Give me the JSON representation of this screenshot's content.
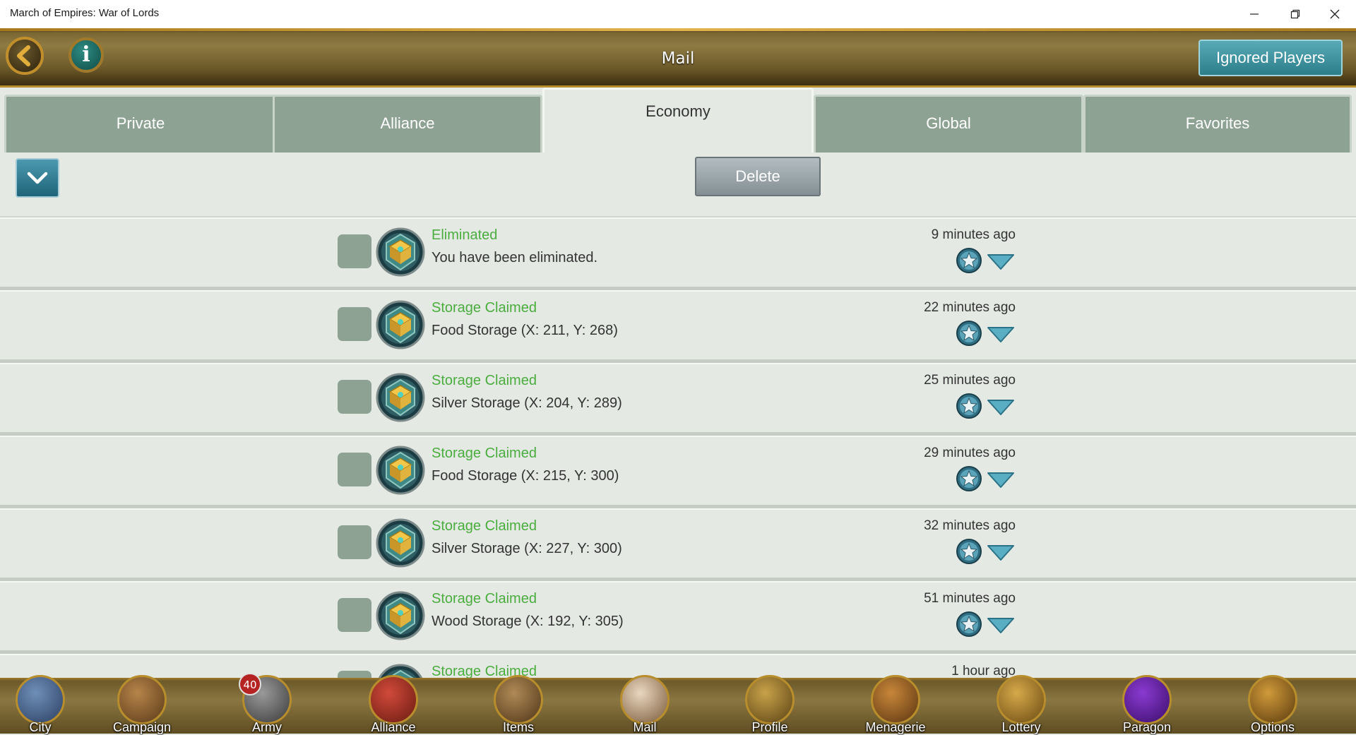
{
  "window": {
    "title": "March of Empires: War of Lords",
    "minimize_icon": "minimize-icon",
    "restore_icon": "restore-icon",
    "close_icon": "close-icon"
  },
  "header": {
    "title": "Mail",
    "back_icon": "back-arrow-icon",
    "info_label": "i",
    "ignored_players_label": "Ignored Players"
  },
  "tabs": [
    {
      "label": "Private",
      "active": false
    },
    {
      "label": "Alliance",
      "active": false
    },
    {
      "label": "Economy",
      "active": true
    },
    {
      "label": "Global",
      "active": false
    },
    {
      "label": "Favorites",
      "active": false
    }
  ],
  "toolbar": {
    "dropdown_icon": "chevron-down-icon",
    "delete_label": "Delete"
  },
  "mails": [
    {
      "subject": "Eliminated",
      "body": "You have been eliminated.",
      "time": "9 minutes ago"
    },
    {
      "subject": "Storage Claimed",
      "body": "Food Storage (X: 211, Y: 268)",
      "time": "22 minutes ago"
    },
    {
      "subject": "Storage Claimed",
      "body": "Silver Storage (X: 204, Y: 289)",
      "time": "25 minutes ago"
    },
    {
      "subject": "Storage Claimed",
      "body": "Food Storage (X: 215, Y: 300)",
      "time": "29 minutes ago"
    },
    {
      "subject": "Storage Claimed",
      "body": "Silver Storage (X: 227, Y: 300)",
      "time": "32 minutes ago"
    },
    {
      "subject": "Storage Claimed",
      "body": "Wood Storage (X: 192, Y: 305)",
      "time": "51 minutes ago"
    },
    {
      "subject": "Storage Claimed",
      "body": "",
      "time": "1 hour ago"
    }
  ],
  "colors": {
    "subject_green": "#4aad3e",
    "tab_inactive": "#8ea294",
    "panel_bg": "#e4e9e4",
    "gold_trim": "#b88d2c"
  },
  "bottom_nav": [
    {
      "label": "City",
      "icon": "castle-icon"
    },
    {
      "label": "Campaign",
      "icon": "horse-icon"
    },
    {
      "label": "Army",
      "icon": "crossed-swords-icon",
      "badge": "40"
    },
    {
      "label": "Alliance",
      "icon": "banner-icon"
    },
    {
      "label": "Items",
      "icon": "backpack-icon"
    },
    {
      "label": "Mail",
      "icon": "envelope-icon"
    },
    {
      "label": "Profile",
      "icon": "helmet-icon"
    },
    {
      "label": "Menagerie",
      "icon": "lion-icon"
    },
    {
      "label": "Lottery",
      "icon": "treasure-chest-icon"
    },
    {
      "label": "Paragon",
      "icon": "purple-gem-icon"
    },
    {
      "label": "Options",
      "icon": "gear-icon"
    }
  ]
}
